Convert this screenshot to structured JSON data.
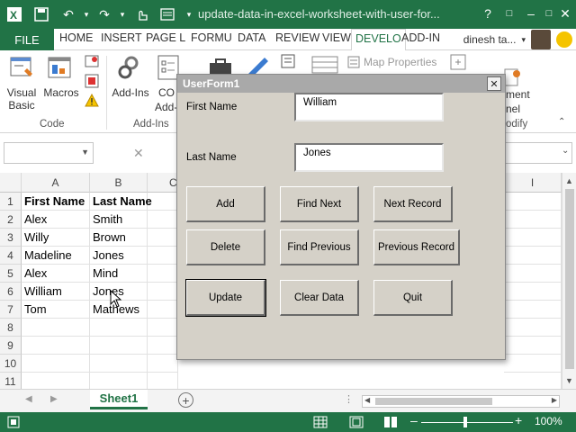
{
  "window": {
    "title": "update-data-in-excel-worksheet-with-user-for...",
    "controls": [
      "?",
      "□",
      "–",
      "□",
      "✕"
    ]
  },
  "tabs": {
    "file": "FILE",
    "items": [
      "HOME",
      "INSERT",
      "PAGE L",
      "FORMU",
      "DATA",
      "REVIEW",
      "VIEW",
      "DEVELO",
      "ADD-IN"
    ],
    "user": "dinesh ta..."
  },
  "ribbon": {
    "visual_basic": "Visual Basic",
    "macros": "Macros",
    "add_ins": "Add-Ins",
    "com_addins_1": "CO",
    "com_addins_2": "Add-",
    "map_properties": "Map Properties",
    "element_1": "ment",
    "element_2": "nel",
    "group_code": "Code",
    "group_addins": "Add-Ins",
    "group_modify": "odify"
  },
  "formula_bar": {
    "cancel": "✕"
  },
  "grid": {
    "columns": [
      "A",
      "B",
      "C",
      "I"
    ],
    "rows": [
      "1",
      "2",
      "3",
      "4",
      "5",
      "6",
      "7",
      "8",
      "9",
      "10",
      "11"
    ],
    "cells": [
      [
        "First Name",
        "Last Name"
      ],
      [
        "Alex",
        "Smith"
      ],
      [
        "Willy",
        "Brown"
      ],
      [
        "Madeline",
        "Jones"
      ],
      [
        "Alex",
        "Mind"
      ],
      [
        "William",
        "Jones"
      ],
      [
        "Tom",
        "Mathews"
      ]
    ]
  },
  "sheets": {
    "active": "Sheet1",
    "add": "+"
  },
  "status": {
    "zoom": "100%",
    "minus": "–",
    "plus": "+"
  },
  "dialog": {
    "title": "UserForm1",
    "close": "✕",
    "first_name_label": "First Name",
    "first_name_value": "William",
    "last_name_label": "Last Name",
    "last_name_value": "Jones",
    "buttons": {
      "add": "Add",
      "find_next": "Find Next",
      "next_record": "Next Record",
      "delete": "Delete",
      "find_previous": "Find Previous",
      "previous_record": "Previous Record",
      "update": "Update",
      "clear_data": "Clear Data",
      "quit": "Quit"
    }
  },
  "colors": {
    "excel_green": "#217346",
    "dialog_bg": "#d5d1c8",
    "dialog_title": "#a9a9a9"
  }
}
